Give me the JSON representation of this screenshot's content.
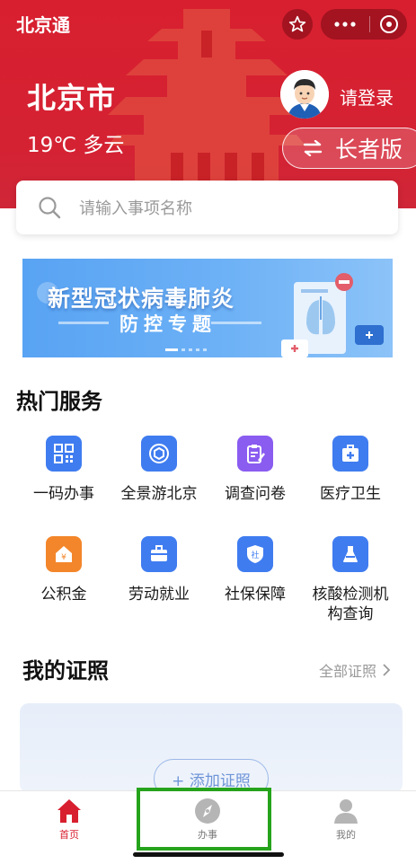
{
  "header": {
    "app_title": "北京通",
    "city": "北京市",
    "weather": "19℃ 多云",
    "login": "请登录",
    "elder_mode": "长者版"
  },
  "search": {
    "placeholder": "请输入事项名称"
  },
  "banner": {
    "line1": "新型冠状病毒肺炎",
    "line2": "防控专题"
  },
  "hot_services": {
    "title": "热门服务",
    "items": [
      {
        "label": "一码办事",
        "icon": "qr-code-icon",
        "color": "#3f7cf0"
      },
      {
        "label": "全景游北京",
        "icon": "panorama-cube-icon",
        "color": "#3f7cf0"
      },
      {
        "label": "调查问卷",
        "icon": "clipboard-pen-icon",
        "color": "#8a5cf0"
      },
      {
        "label": "医疗卫生",
        "icon": "medical-kit-icon",
        "color": "#3f7cf0"
      },
      {
        "label": "公积金",
        "icon": "house-yuan-icon",
        "color": "#f3862a"
      },
      {
        "label": "劳动就业",
        "icon": "briefcase-icon",
        "color": "#3f7cf0"
      },
      {
        "label": "社保保障",
        "icon": "social-security-shield-icon",
        "color": "#3f7cf0"
      },
      {
        "label": "核酸检测机构查询",
        "icon": "flask-icon",
        "color": "#3f7cf0"
      }
    ]
  },
  "certificates": {
    "title": "我的证照",
    "all_link": "全部证照",
    "add_button": "+ 添加证照"
  },
  "tabbar": {
    "items": [
      {
        "label": "首页",
        "icon": "home-icon",
        "active": true
      },
      {
        "label": "办事",
        "icon": "compass-icon",
        "active": false
      },
      {
        "label": "我的",
        "icon": "user-icon",
        "active": false
      }
    ]
  },
  "colors": {
    "brand_red": "#d81f2f",
    "active_tab": "#d81f2f",
    "inactive_tab": "#b5b5b5",
    "highlight_box": "#26a31c"
  }
}
